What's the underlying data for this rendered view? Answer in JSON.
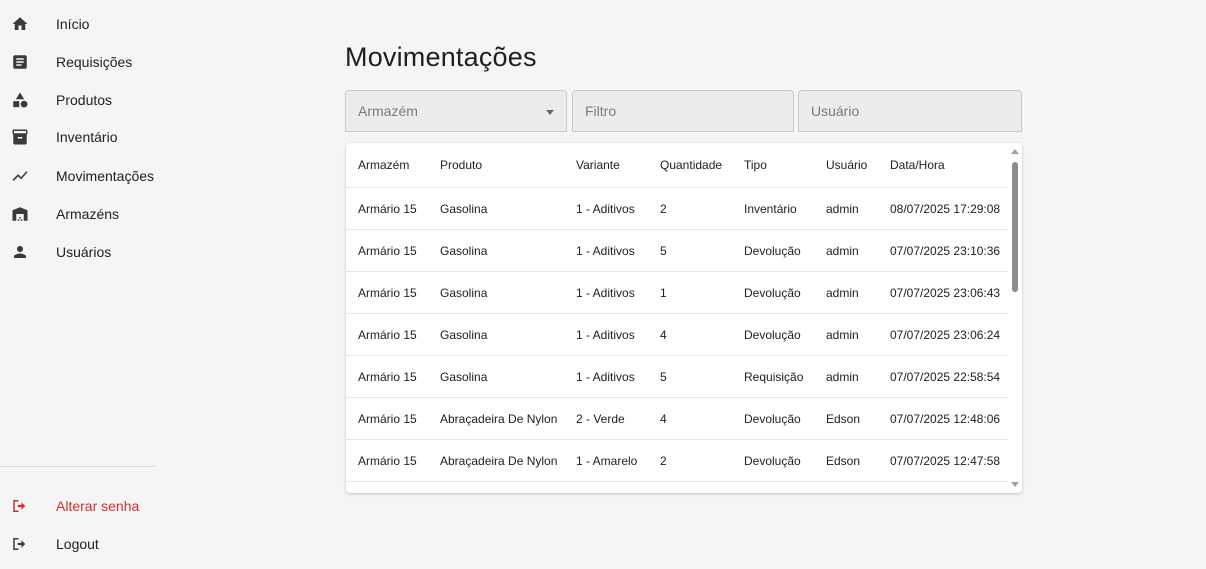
{
  "sidebar": {
    "items": [
      {
        "label": "Início",
        "icon": "home-icon"
      },
      {
        "label": "Requisições",
        "icon": "document-icon"
      },
      {
        "label": "Produtos",
        "icon": "shapes-icon"
      },
      {
        "label": "Inventário",
        "icon": "archive-icon"
      },
      {
        "label": "Movimentações",
        "icon": "trending-icon"
      },
      {
        "label": "Armazéns",
        "icon": "warehouse-icon"
      },
      {
        "label": "Usuários",
        "icon": "person-icon"
      }
    ],
    "bottom": [
      {
        "label": "Alterar senha",
        "icon": "logout-icon",
        "color": "#d32f2f"
      },
      {
        "label": "Logout",
        "icon": "logout-icon",
        "color": "#212121"
      }
    ]
  },
  "page": {
    "title": "Movimentações"
  },
  "filters": {
    "armazem": {
      "value": "Armazém"
    },
    "filtro": {
      "placeholder": "Filtro"
    },
    "usuario": {
      "placeholder": "Usuário"
    }
  },
  "table": {
    "columns": [
      "Armazém",
      "Produto",
      "Variante",
      "Quantidade",
      "Tipo",
      "Usuário",
      "Data/Hora"
    ],
    "rows": [
      [
        "Armário 15",
        "Gasolina",
        "1 - Aditivos",
        "2",
        "Inventário",
        "admin",
        "08/07/2025 17:29:08"
      ],
      [
        "Armário 15",
        "Gasolina",
        "1 - Aditivos",
        "5",
        "Devolução",
        "admin",
        "07/07/2025 23:10:36"
      ],
      [
        "Armário 15",
        "Gasolina",
        "1 - Aditivos",
        "1",
        "Devolução",
        "admin",
        "07/07/2025 23:06:43"
      ],
      [
        "Armário 15",
        "Gasolina",
        "1 - Aditivos",
        "4",
        "Devolução",
        "admin",
        "07/07/2025 23:06:24"
      ],
      [
        "Armário 15",
        "Gasolina",
        "1 - Aditivos",
        "5",
        "Requisição",
        "admin",
        "07/07/2025 22:58:54"
      ],
      [
        "Armário 15",
        "Abraçadeira De Nylon",
        "2 - Verde",
        "4",
        "Devolução",
        "Edson",
        "07/07/2025 12:48:06"
      ],
      [
        "Armário 15",
        "Abraçadeira De Nylon",
        "1 - Amarelo",
        "2",
        "Devolução",
        "Edson",
        "07/07/2025 12:47:58"
      ]
    ]
  },
  "colors": {
    "accent_red": "#d32f2f",
    "background": "#f5f5f5",
    "card": "#ffffff"
  }
}
